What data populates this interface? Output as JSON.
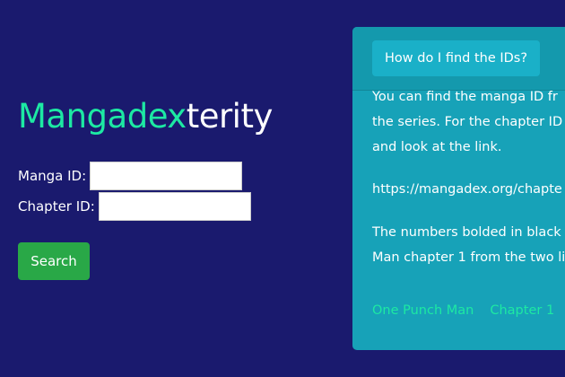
{
  "brand": {
    "accent_text": "Mangadex",
    "rest_text": "terity"
  },
  "form": {
    "manga_label": "Manga ID:",
    "manga_value": "",
    "chapter_label": "Chapter ID:",
    "chapter_value": "",
    "search_label": "Search"
  },
  "help": {
    "tab_label": "How do I find the IDs?",
    "line1": "You can find the manga ID fr",
    "line2": "the series. For the chapter ID",
    "line3": "and look at the link.",
    "url_line": "https://mangadex.org/chapte",
    "line4": "The numbers bolded in black",
    "line5": "Man chapter 1 from the two li",
    "links": [
      "One Punch Man",
      "Chapter 1"
    ]
  },
  "colors": {
    "background": "#1a1a6e",
    "accent": "#1de9a3",
    "card": "#17a2b8",
    "button": "#29a847"
  }
}
